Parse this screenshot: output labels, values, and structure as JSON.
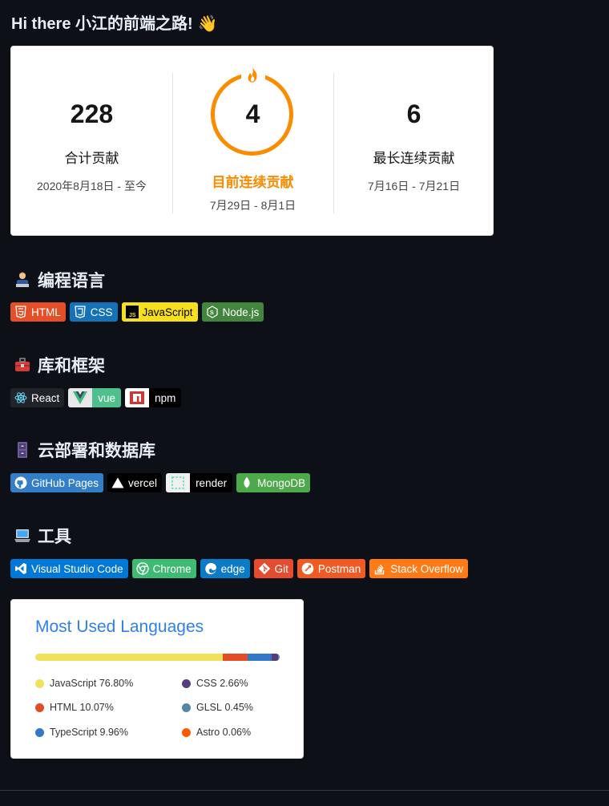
{
  "header": {
    "title": "Hi there 小江的前端之路!"
  },
  "streak": {
    "total": {
      "value": "228",
      "label": "合计贡献",
      "range": "2020年8月18日 - 至今"
    },
    "current": {
      "value": "4",
      "label": "目前连续贡献",
      "range": "7月29日 - 8月1日"
    },
    "longest": {
      "value": "6",
      "label": "最长连续贡献",
      "range": "7月16日 - 7月21日"
    }
  },
  "sections": {
    "languages": {
      "title": "编程语言",
      "badges": [
        "HTML",
        "CSS",
        "JavaScript",
        "Node.js"
      ]
    },
    "frameworks": {
      "title": "库和框架",
      "badges": [
        "React",
        "vue",
        "npm"
      ]
    },
    "cloud": {
      "title": "云部署和数据库",
      "badges": [
        "GitHub Pages",
        "vercel",
        "render",
        "MongoDB"
      ]
    },
    "tools": {
      "title": "工具",
      "badges": [
        "Visual Studio Code",
        "Chrome",
        "edge",
        "Git",
        "Postman",
        "Stack Overflow"
      ]
    }
  },
  "most_used": {
    "title": "Most Used Languages",
    "items": [
      {
        "name": "JavaScript",
        "percent": "76.80%",
        "color": "#f1e05a"
      },
      {
        "name": "HTML",
        "percent": "10.07%",
        "color": "#e34c26"
      },
      {
        "name": "TypeScript",
        "percent": "9.96%",
        "color": "#3178c6"
      },
      {
        "name": "CSS",
        "percent": "2.66%",
        "color": "#563d7c"
      },
      {
        "name": "GLSL",
        "percent": "0.45%",
        "color": "#5686a5"
      },
      {
        "name": "Astro",
        "percent": "0.06%",
        "color": "#ff5a03"
      }
    ]
  },
  "colors": {
    "accent_orange": "#fb8c00",
    "link_blue": "#2f80ed",
    "background": "#0d1117"
  }
}
